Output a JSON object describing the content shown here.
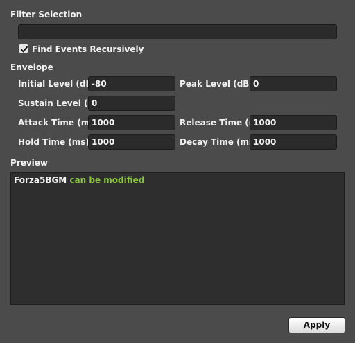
{
  "filter": {
    "title": "Filter Selection",
    "value": "",
    "find_recursive_label": "Find Events Recursively",
    "find_recursive_checked": true
  },
  "envelope": {
    "title": "Envelope",
    "initial_level_label": "Initial Level (dB)",
    "initial_level_value": "-80",
    "peak_level_label": "Peak Level (dB)",
    "peak_level_value": "0",
    "sustain_level_label": "Sustain Level (dB)",
    "sustain_level_value": "0",
    "attack_time_label": "Attack Time (ms)",
    "attack_time_value": "1000",
    "release_time_label": "Release Time (ms)",
    "release_time_value": "1000",
    "hold_time_label": "Hold Time (ms)",
    "hold_time_value": "1000",
    "decay_time_label": "Decay Time (ms)",
    "decay_time_value": "1000"
  },
  "preview": {
    "title": "Preview",
    "item_name": "Forza5BGM",
    "item_status": "can be modified"
  },
  "actions": {
    "apply_label": "Apply"
  },
  "colors": {
    "background": "#4b4b4b",
    "field_background": "#2b2b2b",
    "status_ok": "#8cc63f"
  },
  "icons": {
    "checkbox_mark": "checkmark-icon"
  }
}
